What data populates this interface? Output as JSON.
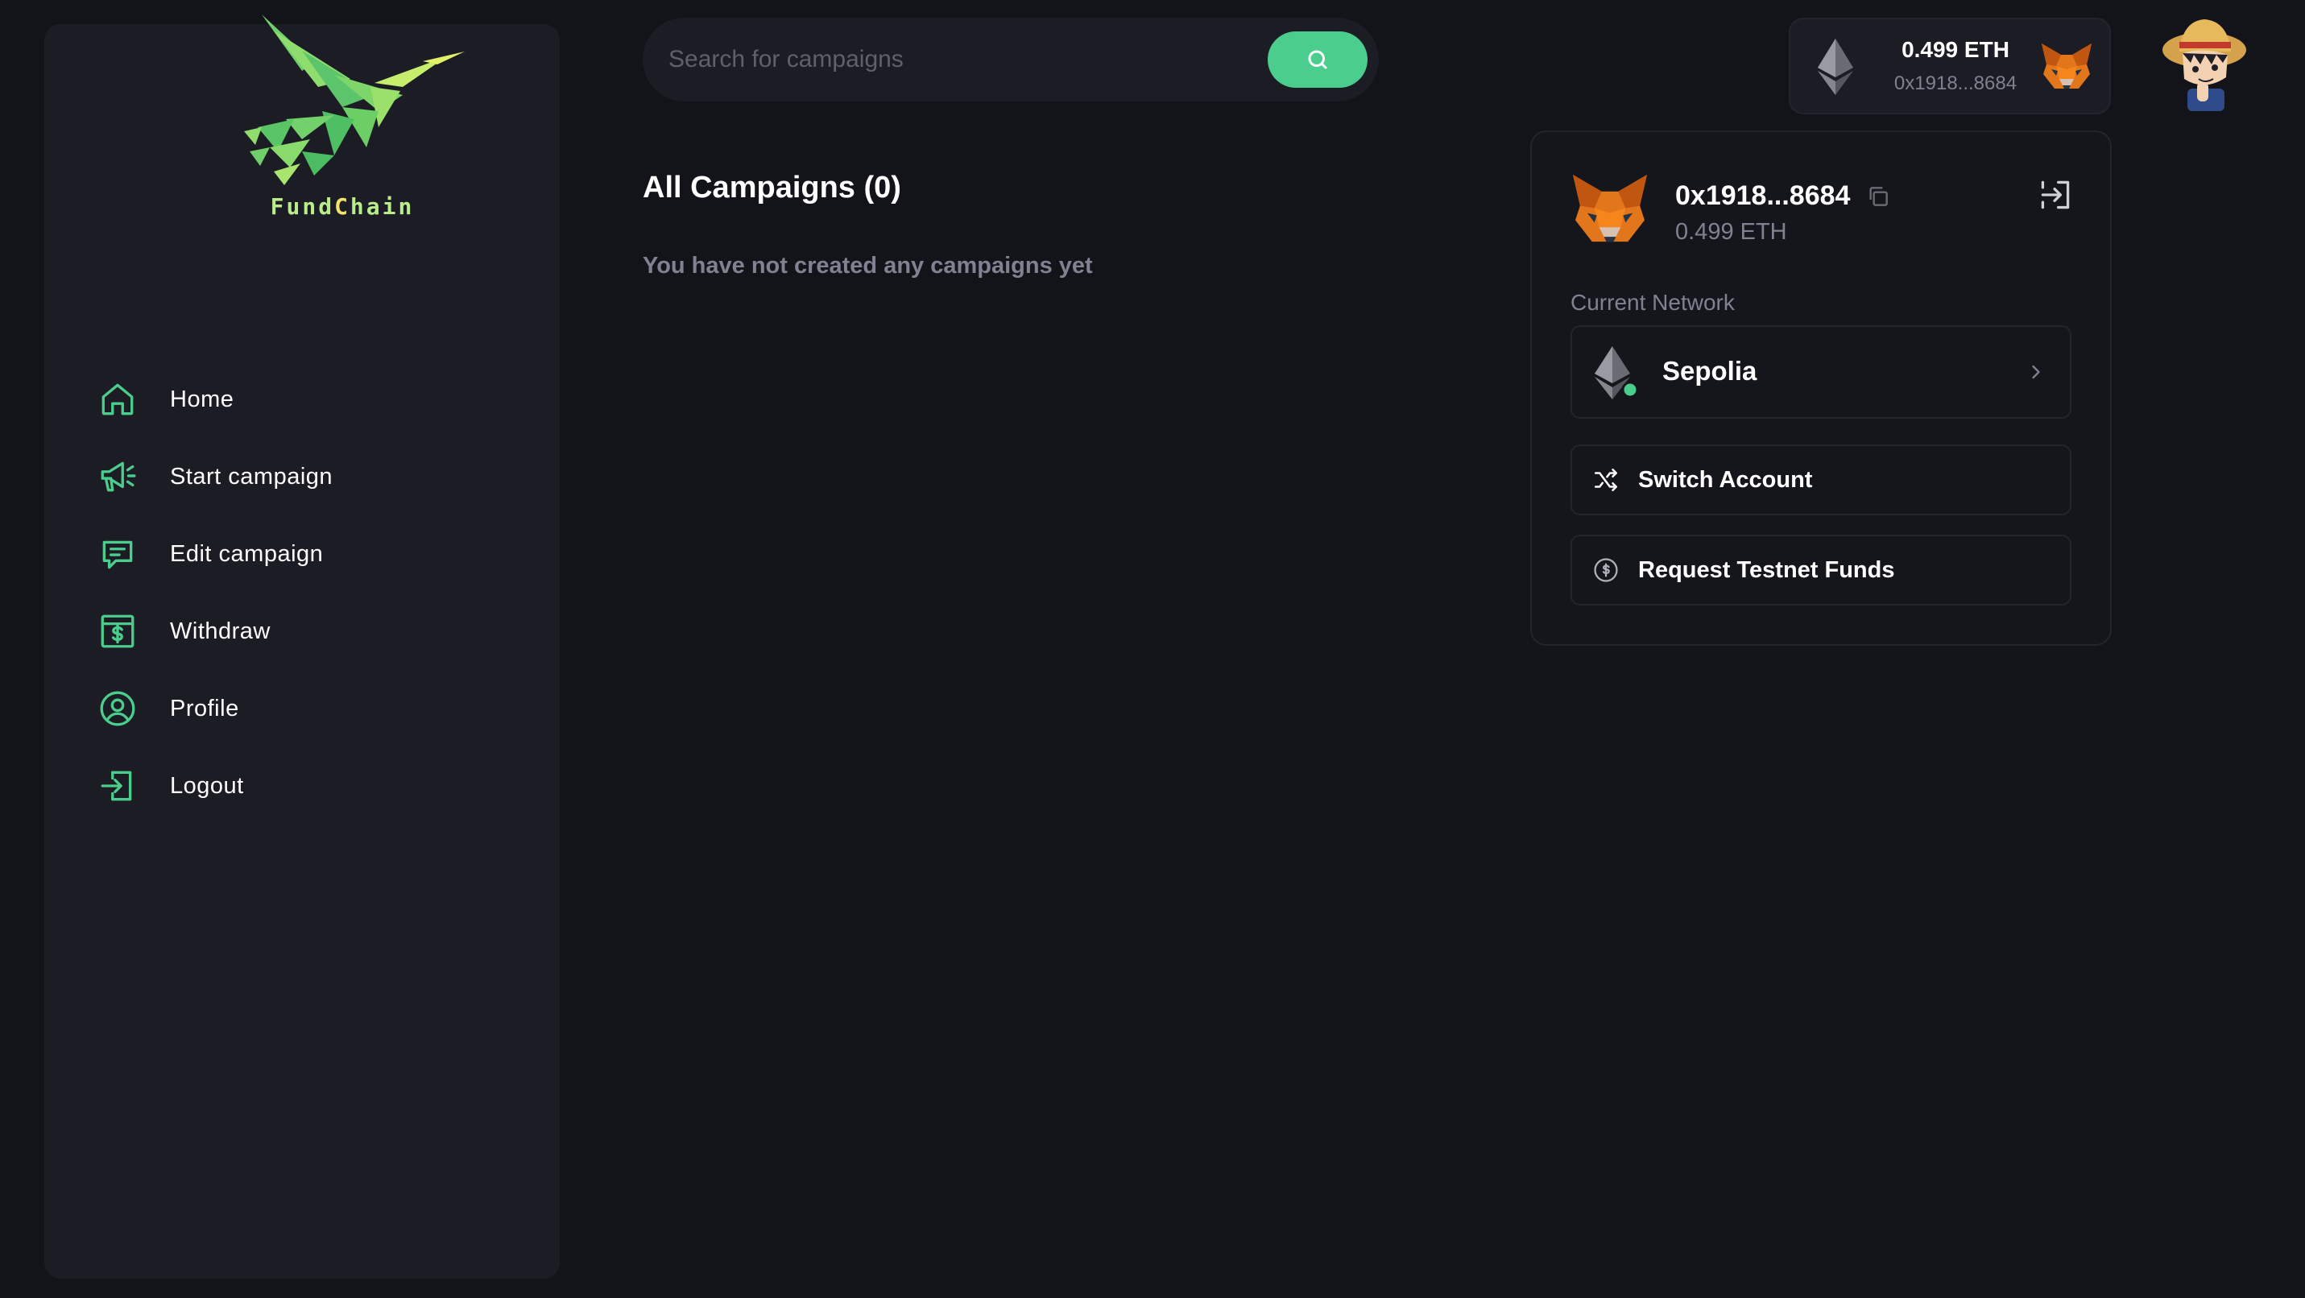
{
  "app": {
    "brand_prefix": "Fund",
    "brand_accent": "C",
    "brand_suffix": "hain",
    "accent_color": "#4acd8d"
  },
  "sidebar": {
    "items": [
      {
        "label": "Home",
        "icon": "home-icon"
      },
      {
        "label": "Start campaign",
        "icon": "megaphone-icon"
      },
      {
        "label": "Edit campaign",
        "icon": "message-icon"
      },
      {
        "label": "Withdraw",
        "icon": "dollar-icon"
      },
      {
        "label": "Profile",
        "icon": "user-icon"
      },
      {
        "label": "Logout",
        "icon": "logout-icon"
      }
    ]
  },
  "search": {
    "placeholder": "Search for campaigns",
    "value": ""
  },
  "main": {
    "title": "All Campaigns (0)",
    "empty_message": "You have not created any campaigns yet"
  },
  "wallet": {
    "balance": "0.499 ETH",
    "address": "0x1918...8684",
    "network_label": "Current Network",
    "network": "Sepolia",
    "switch_account": "Switch Account",
    "request_funds": "Request Testnet Funds"
  }
}
